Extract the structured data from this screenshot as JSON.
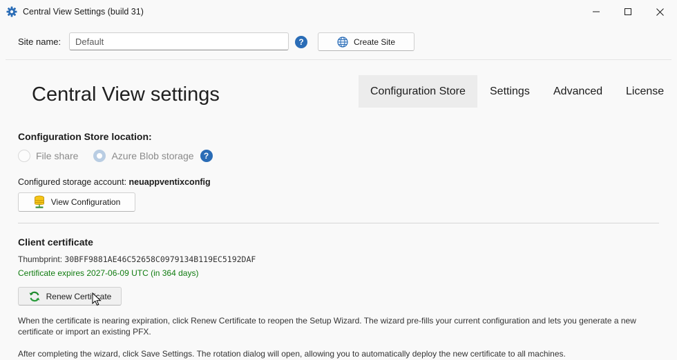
{
  "window": {
    "title": "Central View Settings (build 31)",
    "icon": "gear-icon"
  },
  "site": {
    "label": "Site name:",
    "value": "Default",
    "create_button": "Create Site"
  },
  "panel": {
    "title": "Central View settings"
  },
  "tabs": [
    {
      "label": "Configuration Store",
      "active": true
    },
    {
      "label": "Settings",
      "active": false
    },
    {
      "label": "Advanced",
      "active": false
    },
    {
      "label": "License",
      "active": false
    }
  ],
  "config_store": {
    "heading": "Configuration Store location:",
    "options": [
      {
        "label": "File share",
        "checked": false
      },
      {
        "label": "Azure Blob storage",
        "checked": true
      }
    ],
    "account_label": "Configured storage account:",
    "account_value": "neuappventixconfig",
    "view_button": "View Configuration"
  },
  "certificate": {
    "heading": "Client certificate",
    "thumbprint_label": "Thumbprint:",
    "thumbprint_value": "30BFF9881AE46C52658C0979134B119EC5192DAF",
    "expiry": "Certificate expires 2027-06-09 UTC (in 364 days)",
    "renew_button": "Renew Certificate",
    "desc1_line1": "When the certificate is nearing expiration, click Renew Certificate to reopen the Setup Wizard. The wizard pre-fills your current configuration and lets you generate a new",
    "desc1_line2": "certificate or import an existing PFX.",
    "desc2": "After completing the wizard, click Save Settings. The rotation dialog will open, allowing you to automatically deploy the new certificate to all machines."
  },
  "colors": {
    "accent": "#2a6cb6",
    "success": "#107c10",
    "tab_active_bg": "#ececec"
  }
}
